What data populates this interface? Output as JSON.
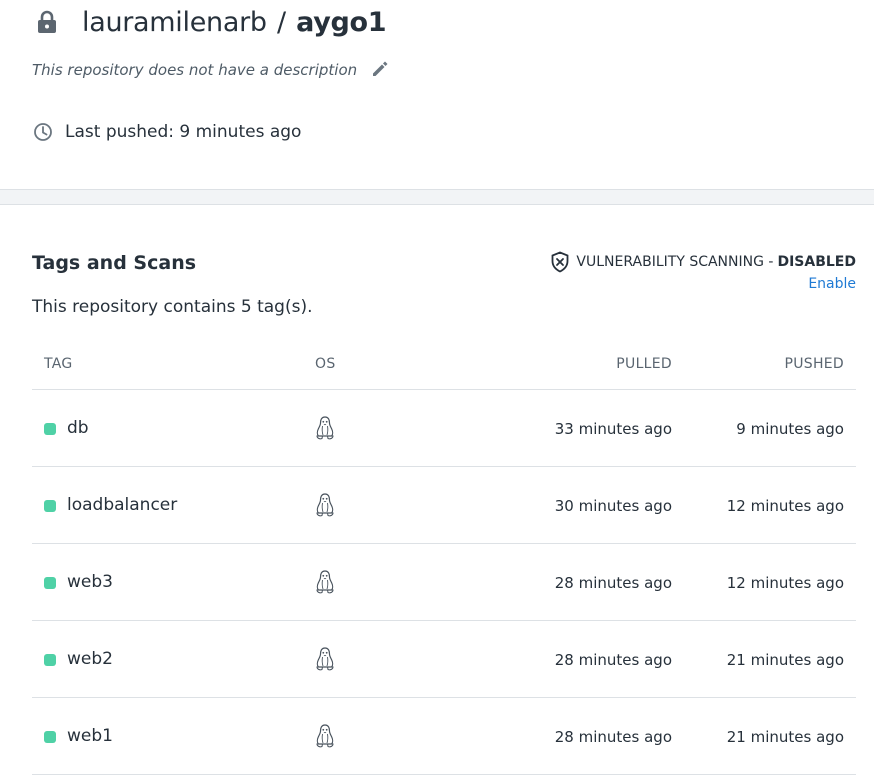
{
  "repo": {
    "namespace": "lauramilenarb",
    "separator": "/",
    "name": "aygo1",
    "description": "This repository does not have a description",
    "last_pushed": "Last pushed: 9 minutes ago",
    "icons": {
      "lock": "lock-icon",
      "edit": "pencil-icon",
      "clock": "clock-icon"
    }
  },
  "tags_section": {
    "title": "Tags and Scans",
    "count_text": "This repository contains 5 tag(s).",
    "vulnerability": {
      "label": "VULNERABILITY SCANNING -",
      "status": "DISABLED",
      "enable_link": "Enable",
      "icon": "shield-x-icon"
    },
    "columns": {
      "tag": "TAG",
      "os": "OS",
      "pulled": "PULLED",
      "pushed": "PUSHED"
    },
    "rows": [
      {
        "tag": "db",
        "os_icon": "linux-icon",
        "pulled": "33 minutes ago",
        "pushed": "9 minutes ago"
      },
      {
        "tag": "loadbalancer",
        "os_icon": "linux-icon",
        "pulled": "30 minutes ago",
        "pushed": "12 minutes ago"
      },
      {
        "tag": "web3",
        "os_icon": "linux-icon",
        "pulled": "28 minutes ago",
        "pushed": "12 minutes ago"
      },
      {
        "tag": "web2",
        "os_icon": "linux-icon",
        "pulled": "28 minutes ago",
        "pushed": "21 minutes ago"
      },
      {
        "tag": "web1",
        "os_icon": "linux-icon",
        "pulled": "28 minutes ago",
        "pushed": "21 minutes ago"
      }
    ]
  },
  "colors": {
    "text": "#27313b",
    "link": "#1f7ad4",
    "tag_status_dot": "#4fd1a6",
    "divider": "#dde1e5",
    "band": "#f2f4f6"
  }
}
